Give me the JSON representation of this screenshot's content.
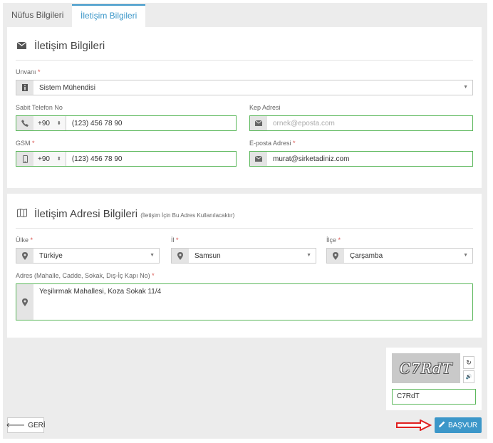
{
  "tabs": [
    {
      "label": "Nüfus Bilgileri"
    },
    {
      "label": "İletişim Bilgileri"
    }
  ],
  "contact": {
    "heading": "İletişim Bilgileri",
    "title_label": "Unvanı",
    "title_value": "Sistem Mühendisi",
    "phone_label": "Sabit Telefon No",
    "phone_cc": "+90",
    "phone_value": "(123) 456 78 90",
    "kep_label": "Kep Adresi",
    "kep_placeholder": "ornek@eposta.com",
    "gsm_label": "GSM",
    "gsm_cc": "+90",
    "gsm_value": "(123) 456 78 90",
    "email_label": "E-posta Adresi",
    "email_value": "murat@sirketadiniz.com"
  },
  "address": {
    "heading": "İletişim Adresi Bilgileri",
    "note": "(İletişim İçin Bu Adres Kullanılacaktır)",
    "country_label": "Ülke",
    "country_value": "Türkiye",
    "city_label": "İl",
    "city_value": "Samsun",
    "district_label": "İlçe",
    "district_value": "Çarşamba",
    "addr_label": "Adres (Mahalle, Cadde, Sokak, Dış-İç Kapı No)",
    "addr_value": "Yeşilırmak Mahallesi, Koza Sokak 11/4"
  },
  "required_mark": "*",
  "captcha": {
    "image_text": "C7RdT",
    "input_value": "C7RdT",
    "refresh_glyph": "↻",
    "audio_glyph": "🔊"
  },
  "actions": {
    "back_label": "GERİ",
    "apply_label": "BAŞVUR"
  },
  "colors": {
    "accent": "#3c97c9",
    "valid_border": "#5cb85c",
    "arrow": "#e02020"
  }
}
